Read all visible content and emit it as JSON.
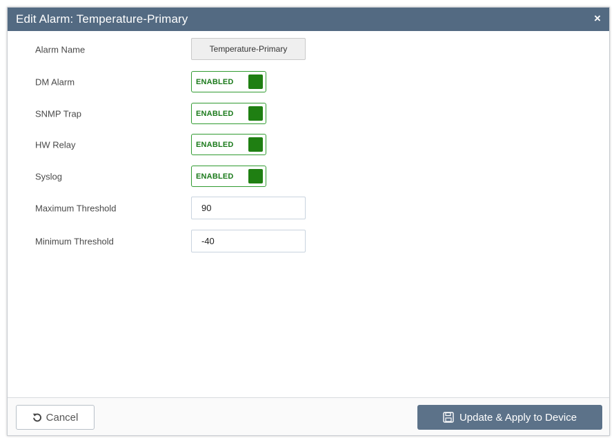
{
  "dialog": {
    "title": "Edit Alarm: Temperature-Primary",
    "close_icon": "×"
  },
  "form": {
    "alarm_name": {
      "label": "Alarm Name",
      "value": "Temperature-Primary"
    },
    "dm_alarm": {
      "label": "DM Alarm",
      "state": "ENABLED"
    },
    "snmp_trap": {
      "label": "SNMP Trap",
      "state": "ENABLED"
    },
    "hw_relay": {
      "label": "HW Relay",
      "state": "ENABLED"
    },
    "syslog": {
      "label": "Syslog",
      "state": "ENABLED"
    },
    "max_threshold": {
      "label": "Maximum Threshold",
      "value": "90"
    },
    "min_threshold": {
      "label": "Minimum Threshold",
      "value": "-40"
    }
  },
  "footer": {
    "cancel_label": "Cancel",
    "apply_label": "Update & Apply to Device"
  },
  "colors": {
    "header_bg": "#536a82",
    "toggle_enabled": "#1f7f12",
    "apply_bg": "#5c7289"
  },
  "icons": {
    "close": "close-icon",
    "cancel": "undo-icon",
    "apply": "save-icon"
  }
}
